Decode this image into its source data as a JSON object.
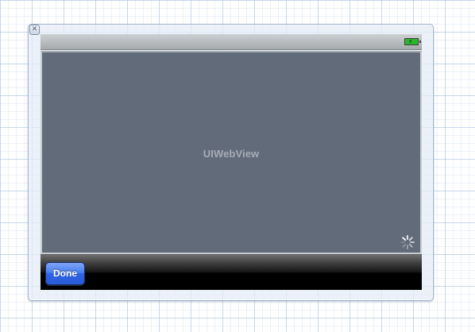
{
  "canvas": {
    "close_glyph": "✕"
  },
  "status_bar": {
    "battery_icon": "battery-charging-icon",
    "battery_color": "#2bb52b"
  },
  "web_view": {
    "label": "UIWebView",
    "background_color": "#626b7a",
    "activity_indicator_icon": "spinner-icon"
  },
  "toolbar": {
    "done_label": "Done",
    "button_color": "#3a6ce8"
  }
}
